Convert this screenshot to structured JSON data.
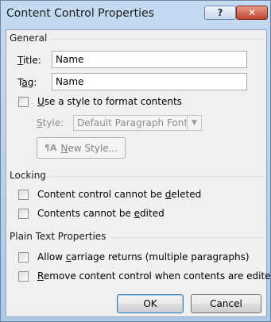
{
  "dialog": {
    "title": "Content Control Properties",
    "help_glyph": "?",
    "close_glyph": "✕"
  },
  "general": {
    "heading": "General",
    "title_label": "Title:",
    "title_value": "Name",
    "tag_label": "Tag:",
    "tag_value": "Name",
    "use_style_label": "Use a style to format contents",
    "use_style_checked": false,
    "style_label": "Style:",
    "style_value": "Default Paragraph Font",
    "new_style_label": "New Style..."
  },
  "locking": {
    "heading": "Locking",
    "cannot_delete_label": "Content control cannot be deleted",
    "cannot_delete_checked": false,
    "cannot_edit_label": "Contents cannot be edited",
    "cannot_edit_checked": false
  },
  "plain_text": {
    "heading": "Plain Text Properties",
    "allow_returns_label": "Allow carriage returns (multiple paragraphs)",
    "allow_returns_checked": false,
    "remove_when_edited_label": "Remove content control when contents are edited",
    "remove_when_edited_checked": false
  },
  "buttons": {
    "ok": "OK",
    "cancel": "Cancel"
  },
  "icons": {
    "new_style_icon": "new-style-icon"
  }
}
